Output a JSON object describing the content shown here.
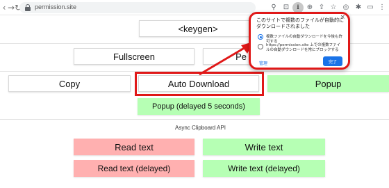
{
  "browser": {
    "url": "permission.site",
    "nav_icons": [
      "back-icon",
      "forward-icon",
      "reload-icon"
    ],
    "toolbar_icons": [
      "location-icon",
      "blocked-popup-icon",
      "download-icon",
      "zoom-icon",
      "share-icon",
      "star-icon",
      "profile-icon",
      "extensions-icon",
      "tab-search-icon",
      "menu-icon"
    ]
  },
  "page": {
    "keygen_label": "<keygen>",
    "fullscreen_label": "Fullscreen",
    "partial_label": "Pe",
    "copy_label": "Copy",
    "auto_download_label": "Auto Download",
    "popup_label": "Popup",
    "popup_delayed_label": "Popup (delayed 5 seconds)",
    "async_clipboard_label": "Async Clipboard API",
    "read_text_label": "Read text",
    "write_text_label": "Write text",
    "read_text_delayed_label": "Read text (delayed)",
    "write_text_delayed_label": "Write text (delayed)"
  },
  "permission_popup": {
    "title": "このサイトで複数のファイルが自動的にダウンロードされました",
    "option_allow": "複数ファイルの自動ダウンロードを今後も許可する",
    "option_block": "https://permission.site 上での複数ファイルの自動ダウンロードを常にブロックする",
    "selected_option": "allow",
    "manage_label": "管理",
    "done_label": "完了"
  },
  "colors": {
    "highlight": "#e01818",
    "green_button": "#b6ffb4",
    "red_button": "#ffb0b0",
    "accent_blue": "#1a73e8"
  }
}
